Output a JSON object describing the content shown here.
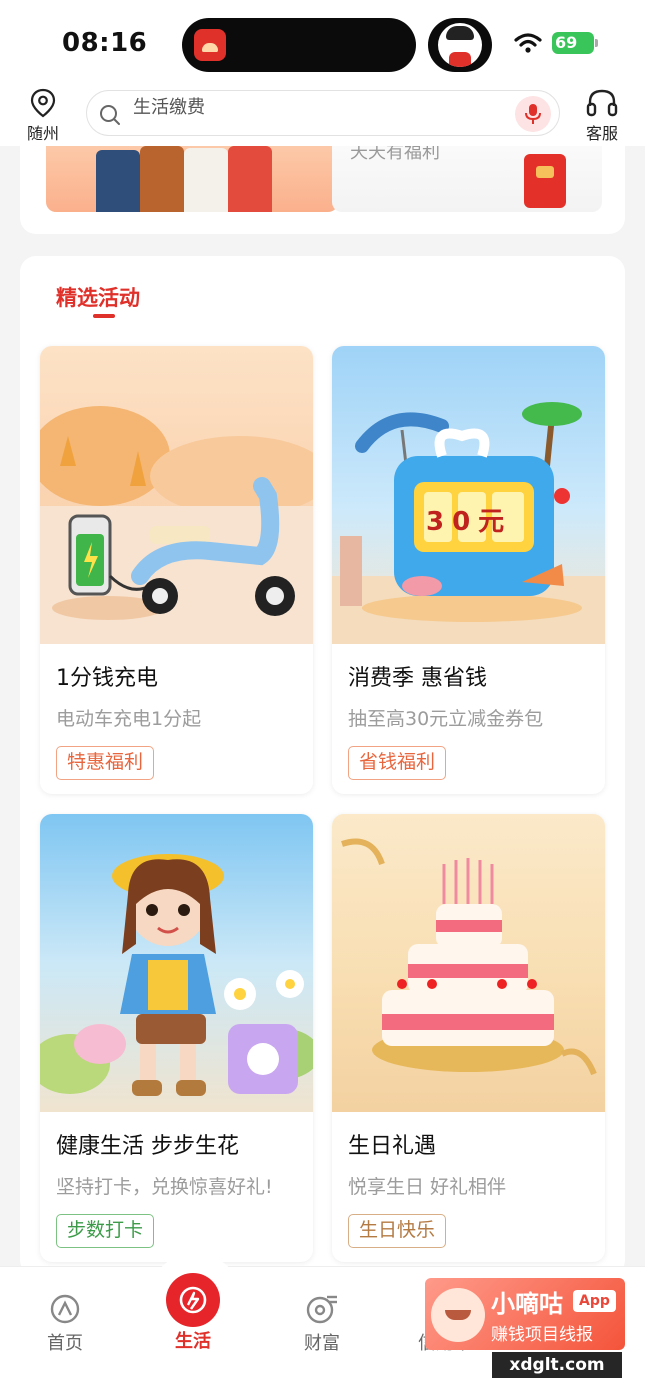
{
  "status_bar": {
    "time": "08:16",
    "battery": "69"
  },
  "header": {
    "location_label": "随州",
    "search_placeholder": "生活缴费",
    "service_label": "客服"
  },
  "top_banner": {
    "right_text": "天天有福利"
  },
  "section": {
    "title": "精选活动"
  },
  "cards": [
    {
      "title": "1分钱充电",
      "subtitle": "电动车充电1分起",
      "tag": "特惠福利",
      "badge_value": ""
    },
    {
      "title": "消费季 惠省钱",
      "subtitle": "抽至高30元立减金券包",
      "tag": "省钱福利",
      "badge_value": "30元"
    },
    {
      "title": "健康生活 步步生花",
      "subtitle": "坚持打卡，兑换惊喜好礼!",
      "tag": "步数打卡",
      "badge_value": ""
    },
    {
      "title": "生日礼遇",
      "subtitle": "悦享生日 好礼相伴",
      "tag": "生日快乐",
      "badge_value": ""
    }
  ],
  "bottom_nav": [
    {
      "label": "首页",
      "icon": "home-icon"
    },
    {
      "label": "生活",
      "icon": "life-icon",
      "active": true
    },
    {
      "label": "财富",
      "icon": "wealth-icon"
    },
    {
      "label": "信用卡",
      "icon": "credit-card-icon"
    }
  ],
  "watermark": {
    "title": "小嘀咕",
    "app": "App",
    "subtitle": "赚钱项目线报",
    "domain": "xdglt.com"
  },
  "colors": {
    "accent": "#e0302a",
    "tag_orange": "#e8663e",
    "tag_green": "#3b9b48",
    "tag_brown": "#b47a43"
  }
}
